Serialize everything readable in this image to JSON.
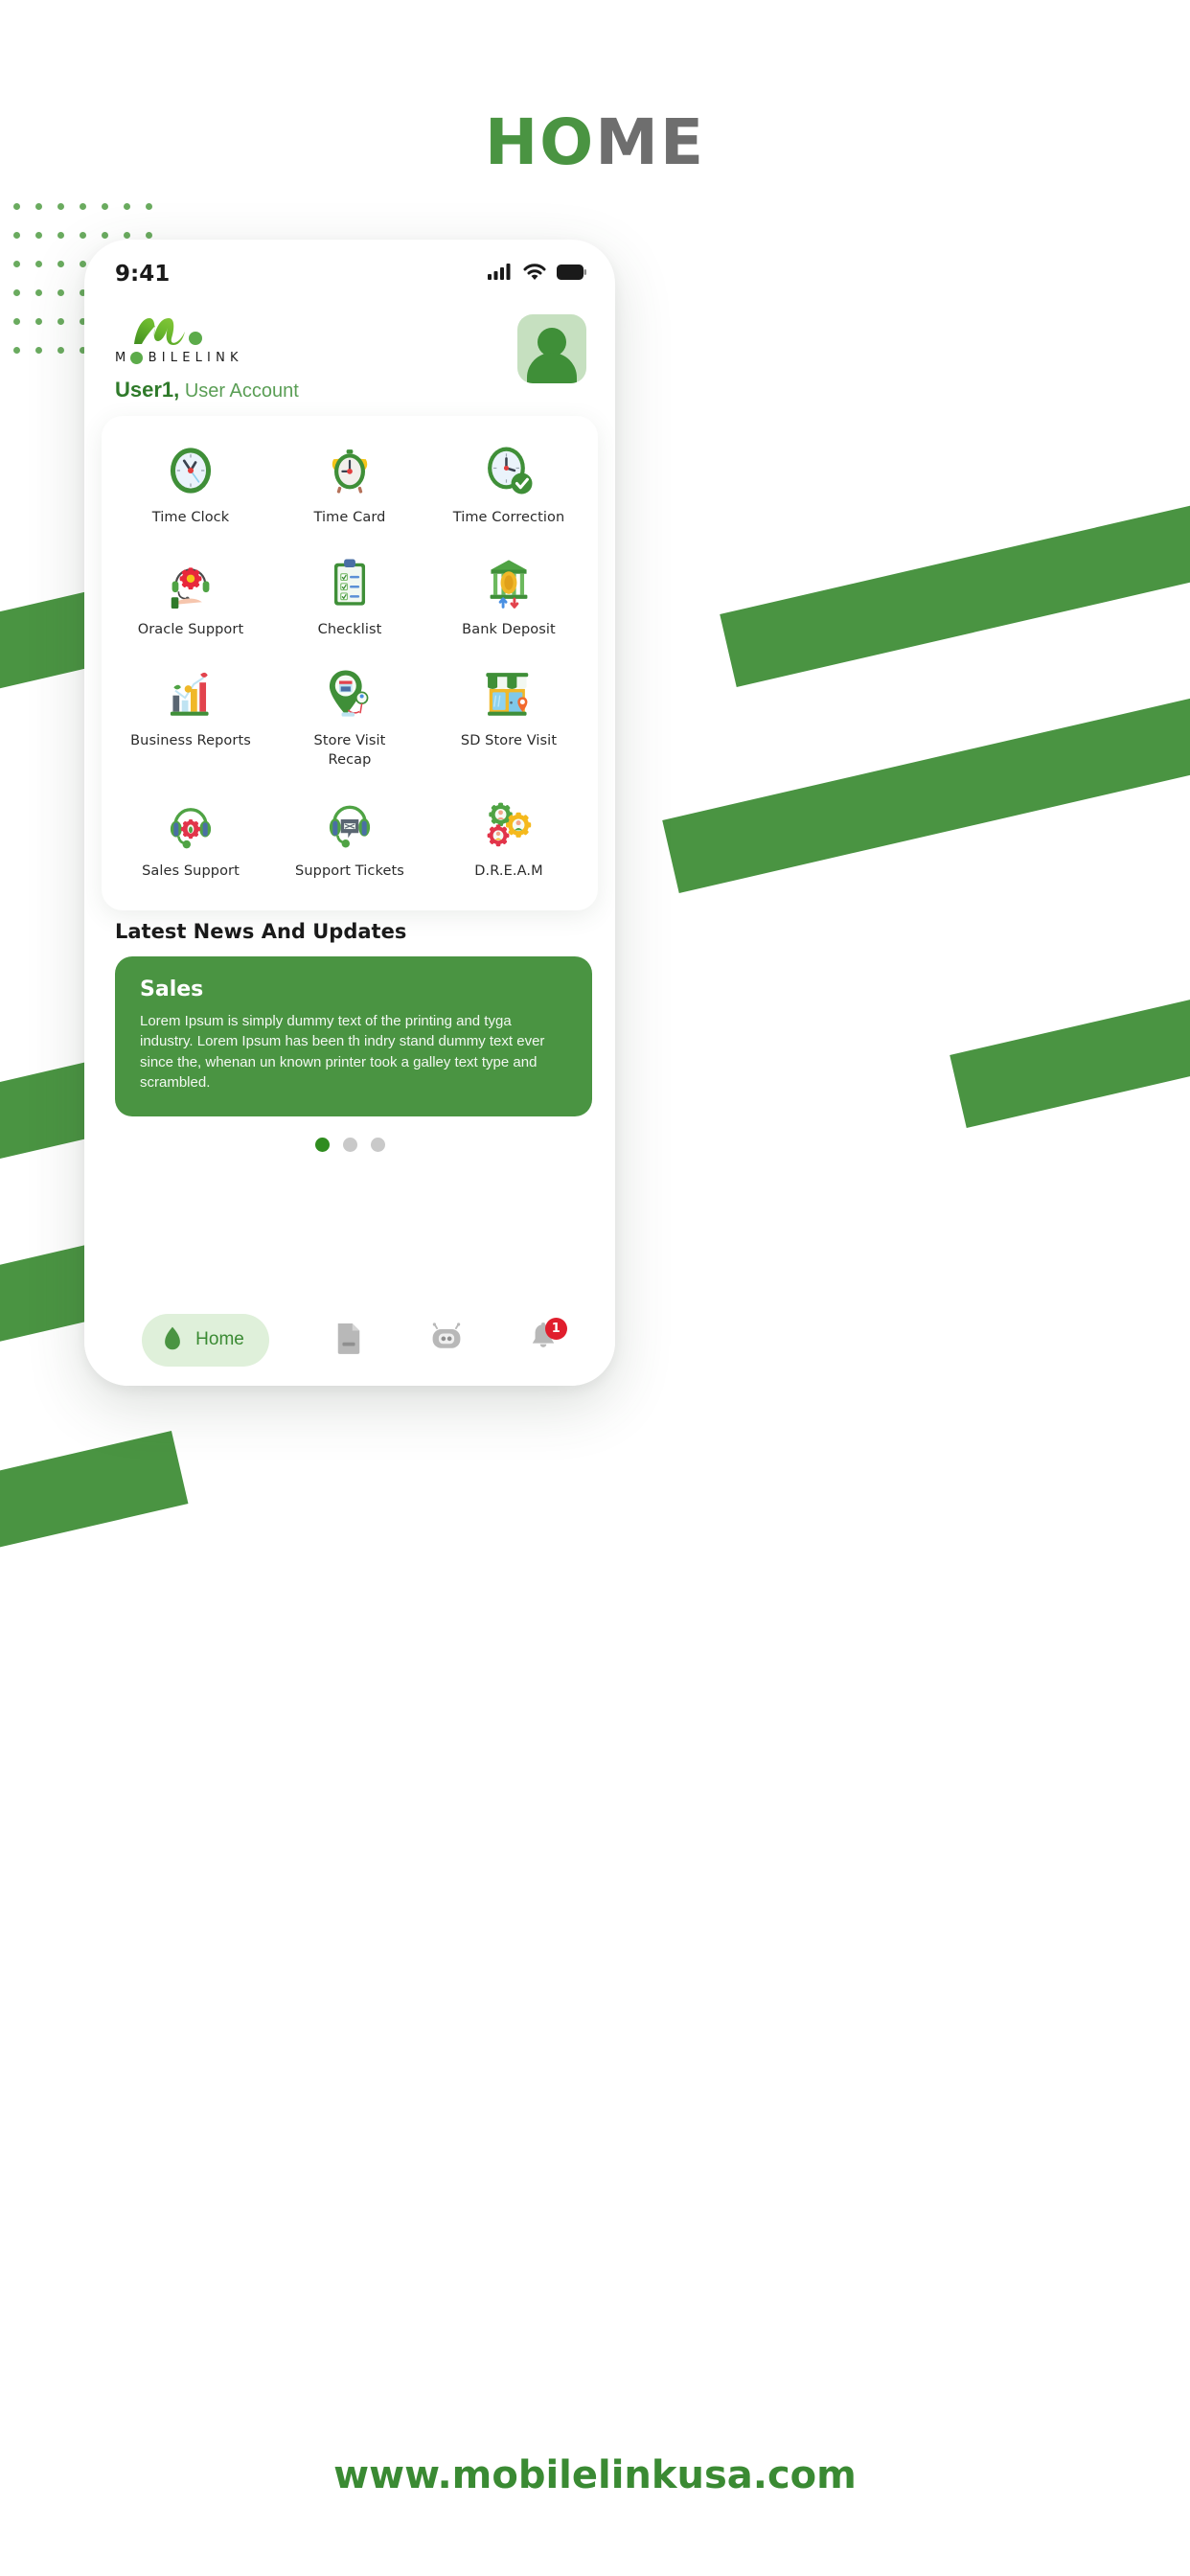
{
  "page": {
    "title_green": "HO",
    "title_gray": "ME",
    "footer_url": "www.mobilelinkusa.com",
    "accent_green": "#4a9442",
    "dark_green": "#2f7a2a",
    "gray": "#6e6e6e"
  },
  "statusbar": {
    "time": "9:41",
    "signal_icon": "cellular-signal-icon",
    "wifi_icon": "wifi-icon",
    "battery_icon": "battery-icon"
  },
  "header": {
    "logo_mark": "mobilelink-m-logo",
    "wordmark": "MOBILELINK",
    "wordmark_letters": [
      "M",
      "O",
      "B",
      "I",
      "L",
      "E",
      "L",
      "I",
      "N",
      "K"
    ],
    "user_name": "User1,",
    "user_role": "User Account",
    "avatar_icon": "user-avatar-icon"
  },
  "apps": [
    {
      "label": "Time Clock",
      "icon": "clock-icon"
    },
    {
      "label": "Time Card",
      "icon": "alarm-clock-icon"
    },
    {
      "label": "Time Correction",
      "icon": "clock-check-icon"
    },
    {
      "label": "Oracle Support",
      "icon": "headset-gear-hand-icon"
    },
    {
      "label": "Checklist",
      "icon": "clipboard-checklist-icon"
    },
    {
      "label": "Bank Deposit",
      "icon": "bank-coin-icon"
    },
    {
      "label": "Business Reports",
      "icon": "bar-chart-icon"
    },
    {
      "label": "Store Visit\nRecap",
      "icon": "map-pin-store-icon"
    },
    {
      "label": "SD Store Visit",
      "icon": "storefront-icon"
    },
    {
      "label": "Sales Support",
      "icon": "headset-rose-icon"
    },
    {
      "label": "Support Tickets",
      "icon": "headset-chat-icon"
    },
    {
      "label": "D.R.E.A.M",
      "icon": "gears-people-icon"
    }
  ],
  "news": {
    "section_title": "Latest News And Updates",
    "card_title": "Sales",
    "card_body": "Lorem Ipsum is simply dummy text of the printing and tyga industry. Lorem Ipsum has been th indry stand dummy text ever since the, whenan un known printer took a galley text type and scrambled.",
    "dots_total": 3,
    "dots_active_index": 0
  },
  "navbar": {
    "items": [
      {
        "label": "Home",
        "icon": "home-icon",
        "active": true,
        "badge": ""
      },
      {
        "label": "",
        "icon": "document-icon",
        "active": false,
        "badge": ""
      },
      {
        "label": "",
        "icon": "robot-chat-icon",
        "active": false,
        "badge": ""
      },
      {
        "label": "",
        "icon": "bell-notification-icon",
        "active": false,
        "badge": "1"
      }
    ]
  }
}
